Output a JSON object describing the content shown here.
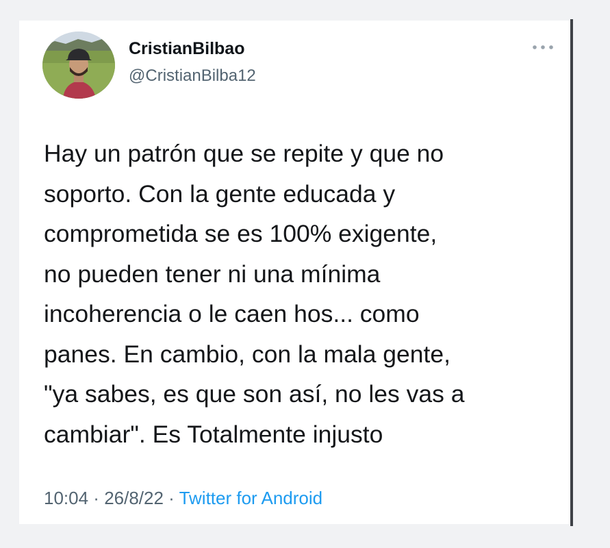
{
  "user": {
    "display_name": "CristianBilbao",
    "handle": "@CristianBilba12"
  },
  "tweet": {
    "lines": [
      "Hay un patrón que se repite y que no",
      "soporto. Con la gente educada y",
      "comprometida se es 100% exigente,",
      "no pueden tener ni una mínima",
      "incoherencia o le caen hos... como",
      "panes. En cambio, con la mala gente,",
      "\"ya sabes, es que son así, no les vas a",
      "cambiar\". Es Totalmente injusto"
    ]
  },
  "meta": {
    "time": "10:04",
    "separator": " · ",
    "date": "26/8/22",
    "source": "Twitter for Android"
  },
  "icons": {
    "more": "more-horizontal-icon",
    "avatar": "user-avatar-photo"
  },
  "colors": {
    "name": "#0f1419",
    "secondary": "#536471",
    "link": "#1d9bf0",
    "background": "#ffffff",
    "page": "#f1f2f4"
  }
}
